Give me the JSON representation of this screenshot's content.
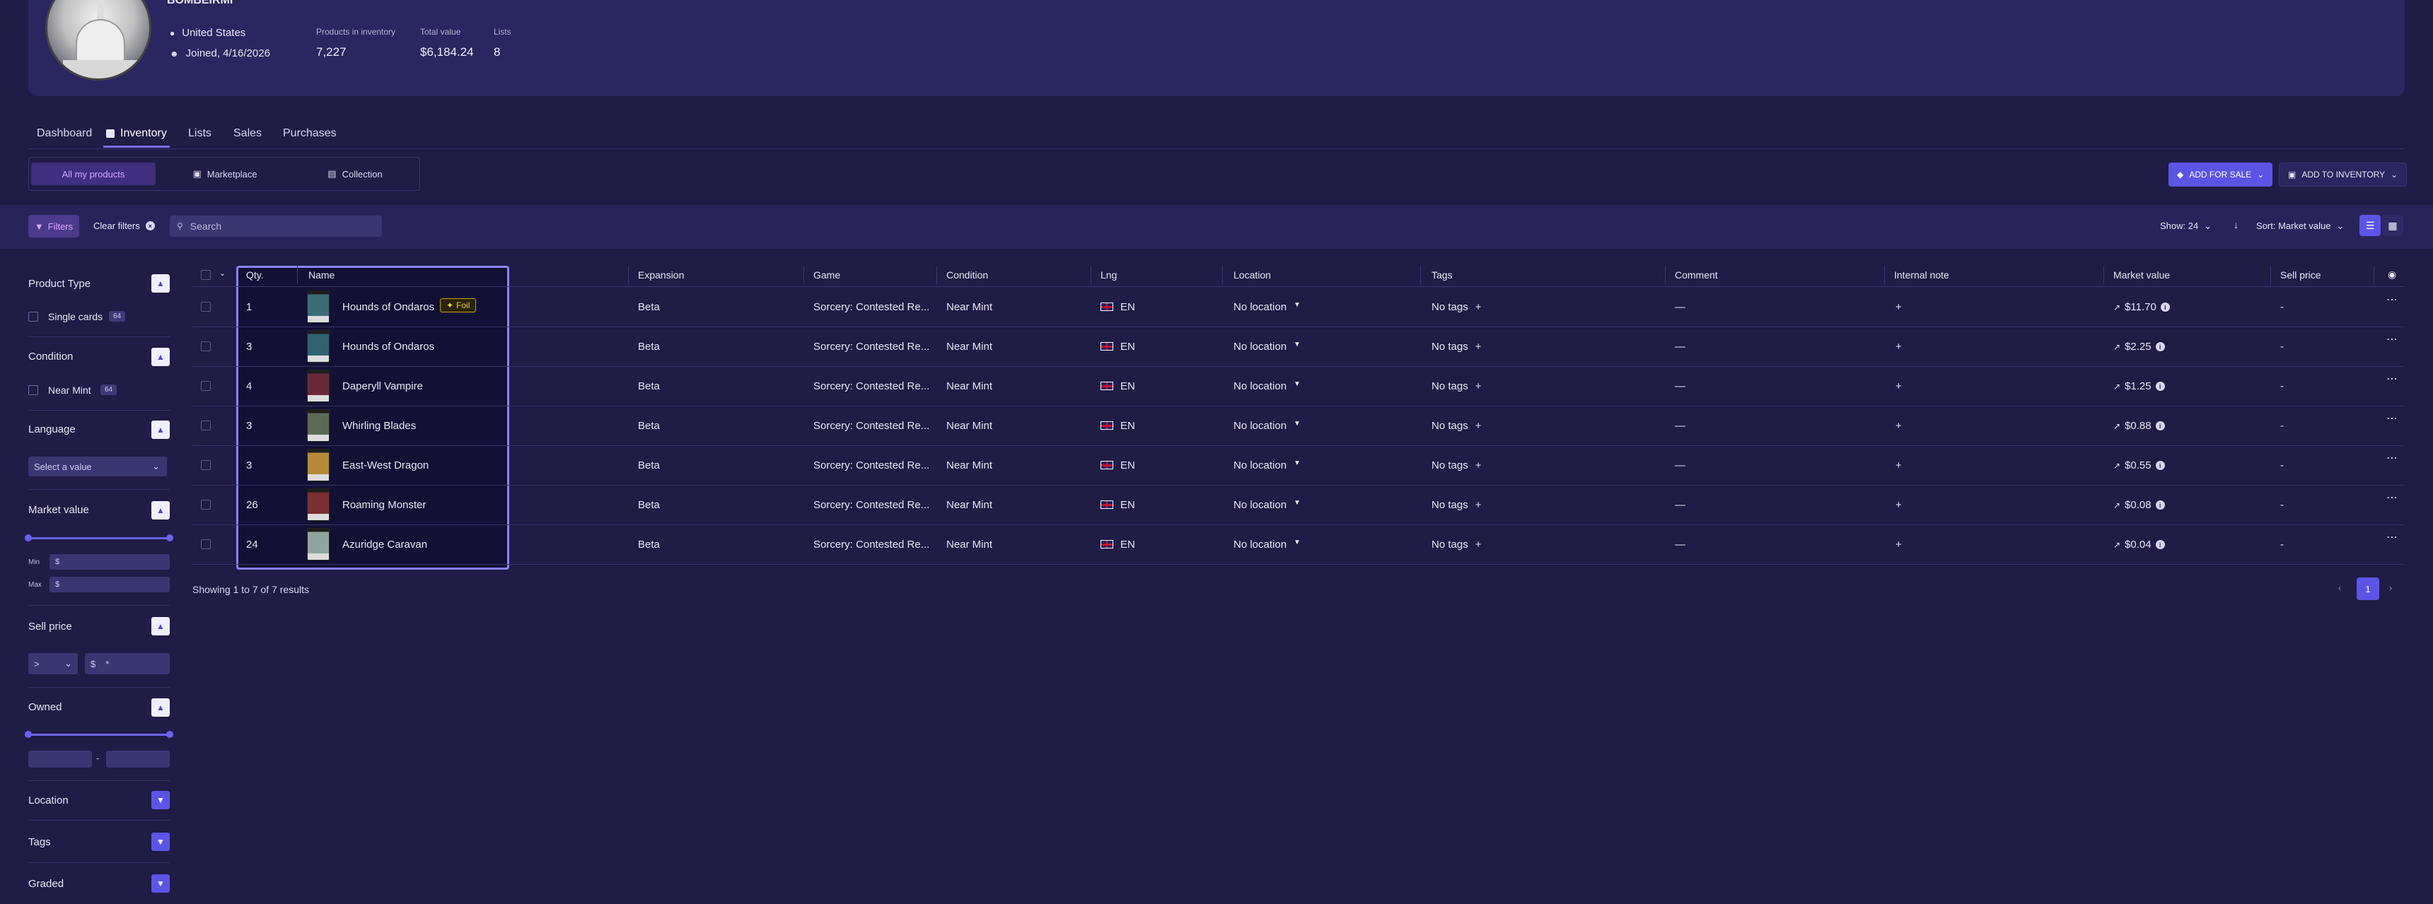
{
  "profile": {
    "name": "BOMBEIRMI",
    "country": "United States",
    "joined": "Joined, 4/16/2026",
    "stats": [
      {
        "label": "Products in inventory",
        "value": "7,227"
      },
      {
        "label": "Total value",
        "value": "$6,184.24"
      },
      {
        "label": "Lists",
        "value": "8"
      }
    ]
  },
  "tabs": [
    "Dashboard",
    "Inventory",
    "Lists",
    "Sales",
    "Purchases"
  ],
  "segments": [
    "All my products",
    "Marketplace",
    "Collection"
  ],
  "actions": {
    "add_for_sale": "ADD FOR SALE",
    "add_to_inventory": "ADD TO INVENTORY"
  },
  "filterbar": {
    "filters": "Filters",
    "clear": "Clear filters",
    "search_placeholder": "Search",
    "show": "Show: 24",
    "sort": "Sort: Market value"
  },
  "sidebar": {
    "product_type": {
      "title": "Product Type",
      "option": "Single cards",
      "count": "64"
    },
    "condition": {
      "title": "Condition",
      "option": "Near Mint",
      "count": "64"
    },
    "language": {
      "title": "Language",
      "placeholder": "Select a value"
    },
    "market_value": {
      "title": "Market value",
      "min": "Min",
      "max": "Max",
      "currency": "$"
    },
    "sell_price": {
      "title": "Sell price",
      "op": ">",
      "currency": "$",
      "value": "*"
    },
    "owned": {
      "title": "Owned",
      "sep": "-"
    },
    "location": {
      "title": "Location"
    },
    "tags": {
      "title": "Tags"
    },
    "graded": {
      "title": "Graded"
    }
  },
  "table": {
    "headers": [
      "Qty.",
      "Name",
      "Expansion",
      "Game",
      "Condition",
      "Lng",
      "Location",
      "Tags",
      "Comment",
      "Internal note",
      "Market value",
      "Sell price"
    ],
    "rows": [
      {
        "qty": "1",
        "name": "Hounds of Ondaros",
        "foil": "Foil",
        "expansion": "Beta",
        "game": "Sorcery: Contested Re...",
        "condition": "Near Mint",
        "lng": "EN",
        "location": "No location",
        "tags": "No tags",
        "comment": "—",
        "note": "+",
        "market": "$11.70",
        "sell": "-",
        "thumb": "#3b6d78"
      },
      {
        "qty": "3",
        "name": "Hounds of Ondaros",
        "foil": "",
        "expansion": "Beta",
        "game": "Sorcery: Contested Re...",
        "condition": "Near Mint",
        "lng": "EN",
        "location": "No location",
        "tags": "No tags",
        "comment": "—",
        "note": "+",
        "market": "$2.25",
        "sell": "-",
        "thumb": "#2f6270"
      },
      {
        "qty": "4",
        "name": "Daperyll Vampire",
        "foil": "",
        "expansion": "Beta",
        "game": "Sorcery: Contested Re...",
        "condition": "Near Mint",
        "lng": "EN",
        "location": "No location",
        "tags": "No tags",
        "comment": "—",
        "note": "+",
        "market": "$1.25",
        "sell": "-",
        "thumb": "#6b2a3a"
      },
      {
        "qty": "3",
        "name": "Whirling Blades",
        "foil": "",
        "expansion": "Beta",
        "game": "Sorcery: Contested Re...",
        "condition": "Near Mint",
        "lng": "EN",
        "location": "No location",
        "tags": "No tags",
        "comment": "—",
        "note": "+",
        "market": "$0.88",
        "sell": "-",
        "thumb": "#5c6a58"
      },
      {
        "qty": "3",
        "name": "East-West Dragon",
        "foil": "",
        "expansion": "Beta",
        "game": "Sorcery: Contested Re...",
        "condition": "Near Mint",
        "lng": "EN",
        "location": "No location",
        "tags": "No tags",
        "comment": "—",
        "note": "+",
        "market": "$0.55",
        "sell": "-",
        "thumb": "#b48a3a"
      },
      {
        "qty": "26",
        "name": "Roaming Monster",
        "foil": "",
        "expansion": "Beta",
        "game": "Sorcery: Contested Re...",
        "condition": "Near Mint",
        "lng": "EN",
        "location": "No location",
        "tags": "No tags",
        "comment": "—",
        "note": "+",
        "market": "$0.08",
        "sell": "-",
        "thumb": "#7a3030"
      },
      {
        "qty": "24",
        "name": "Azuridge Caravan",
        "foil": "",
        "expansion": "Beta",
        "game": "Sorcery: Contested Re...",
        "condition": "Near Mint",
        "lng": "EN",
        "location": "No location",
        "tags": "No tags",
        "comment": "—",
        "note": "+",
        "market": "$0.04",
        "sell": "-",
        "thumb": "#8fa6a0"
      }
    ]
  },
  "footer": {
    "showing": "Showing 1 to 7 of 7 results",
    "page": "1"
  }
}
